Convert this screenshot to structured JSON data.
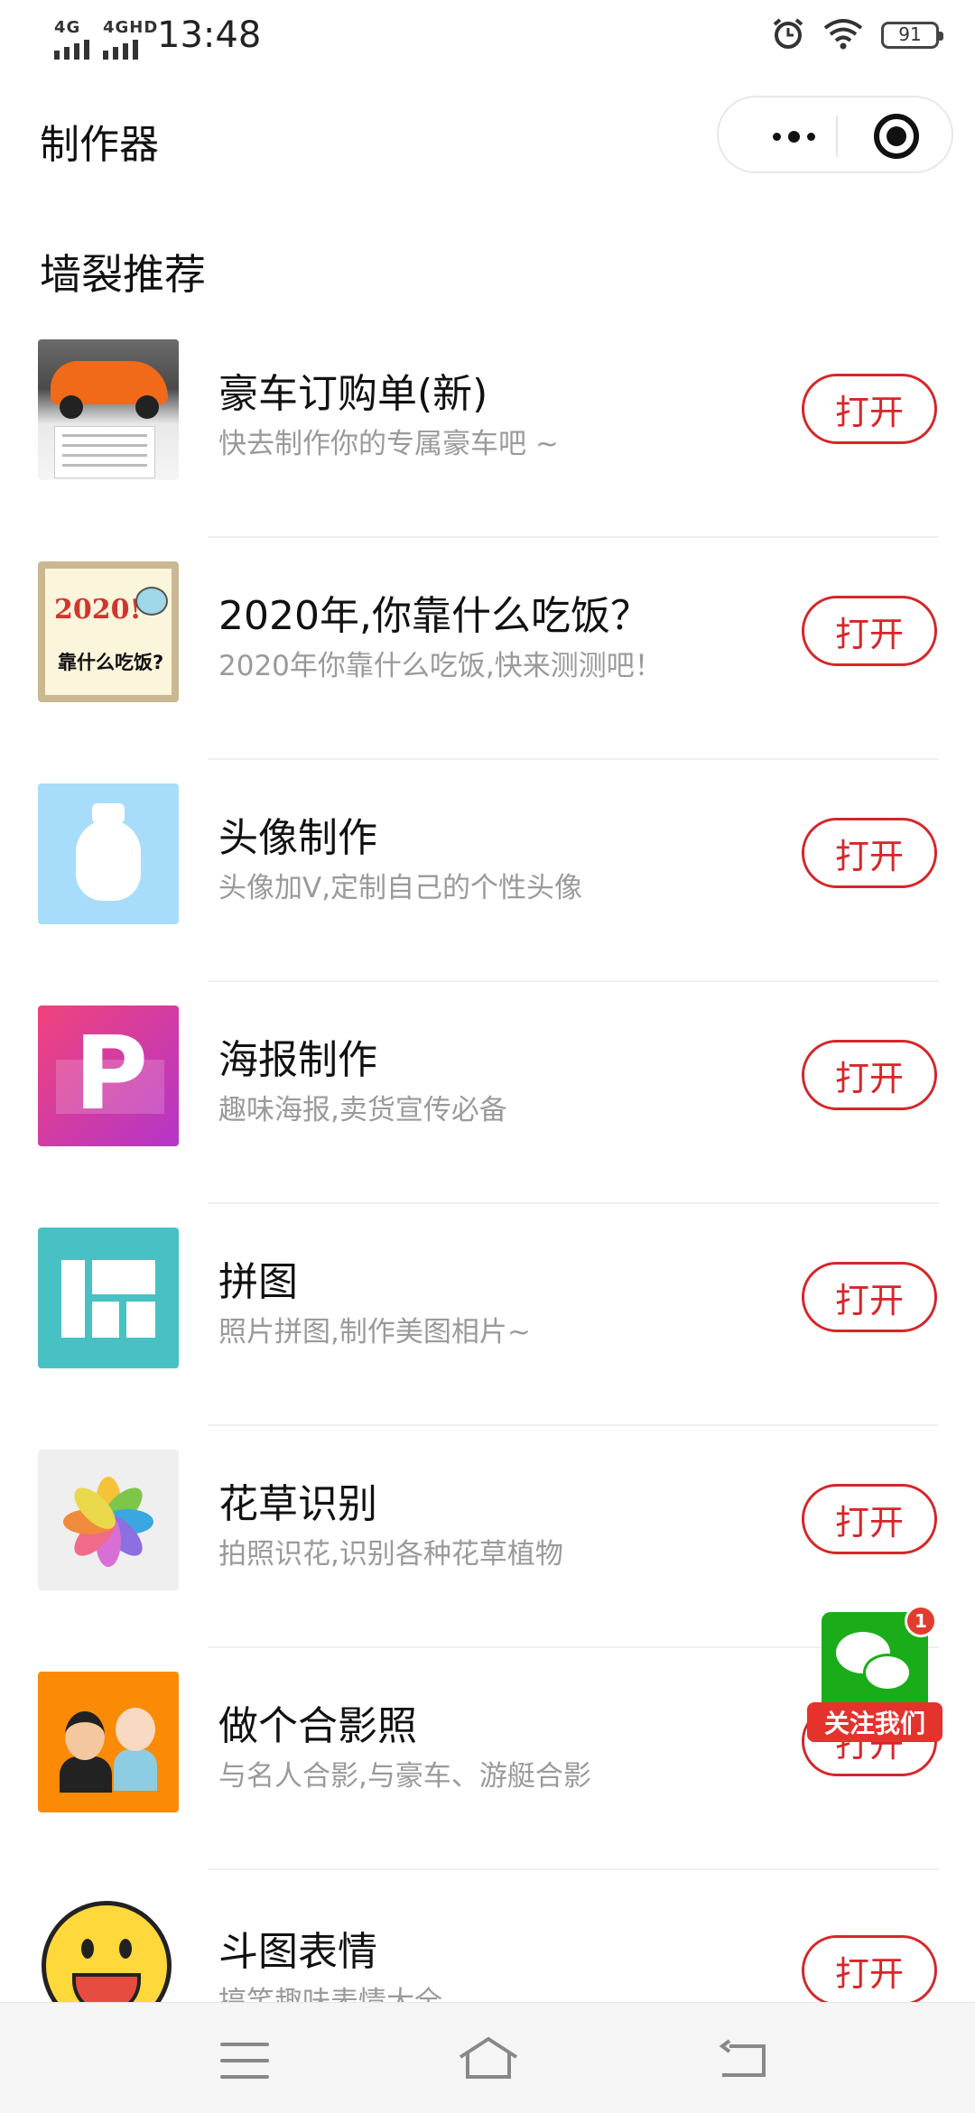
{
  "status_bar": {
    "network_1": "4G",
    "network_2": "4GHD",
    "time": "13:48",
    "battery": "91"
  },
  "nav": {
    "title": "制作器",
    "more_icon": "more-dots-icon",
    "close_icon": "target-circle-icon"
  },
  "section": {
    "title": "墙裂推荐"
  },
  "items": [
    {
      "title": "豪车订购单(新)",
      "desc": "快去制作你的专属豪车吧 ~",
      "button": "打开",
      "icon": "sports-car-thumbnail"
    },
    {
      "title": "2020年,你靠什么吃饭？",
      "desc": "2020年你靠什么吃饭,快来测测吧！",
      "button": "打开",
      "icon": "2020-mouse-thumbnail",
      "thumb_year": "2020!",
      "thumb_question": "靠什么吃饭?"
    },
    {
      "title": "头像制作",
      "desc": "头像加V,定制自己的个性头像",
      "button": "打开",
      "icon": "avatar-thumbnail"
    },
    {
      "title": "海报制作",
      "desc": "趣味海报,卖货宣传必备",
      "button": "打开",
      "icon": "poster-p-thumbnail",
      "thumb_letter": "P"
    },
    {
      "title": "拼图",
      "desc": "照片拼图,制作美图相片~",
      "button": "打开",
      "icon": "collage-thumbnail"
    },
    {
      "title": "花草识别",
      "desc": "拍照识花,识别各种花草植物",
      "button": "打开",
      "icon": "flower-petals-thumbnail"
    },
    {
      "title": "做个合影照",
      "desc": "与名人合影,与豪车、游艇合影",
      "button": "打开",
      "icon": "group-photo-thumbnail"
    },
    {
      "title": "斗图表情",
      "desc": "搞笑趣味表情大全",
      "button": "打开",
      "icon": "emoji-face-thumbnail"
    }
  ],
  "follow": {
    "badge": "1",
    "label": "关注我们"
  },
  "colors": {
    "accent": "#d6262a",
    "wechat_green": "#1aad19"
  }
}
